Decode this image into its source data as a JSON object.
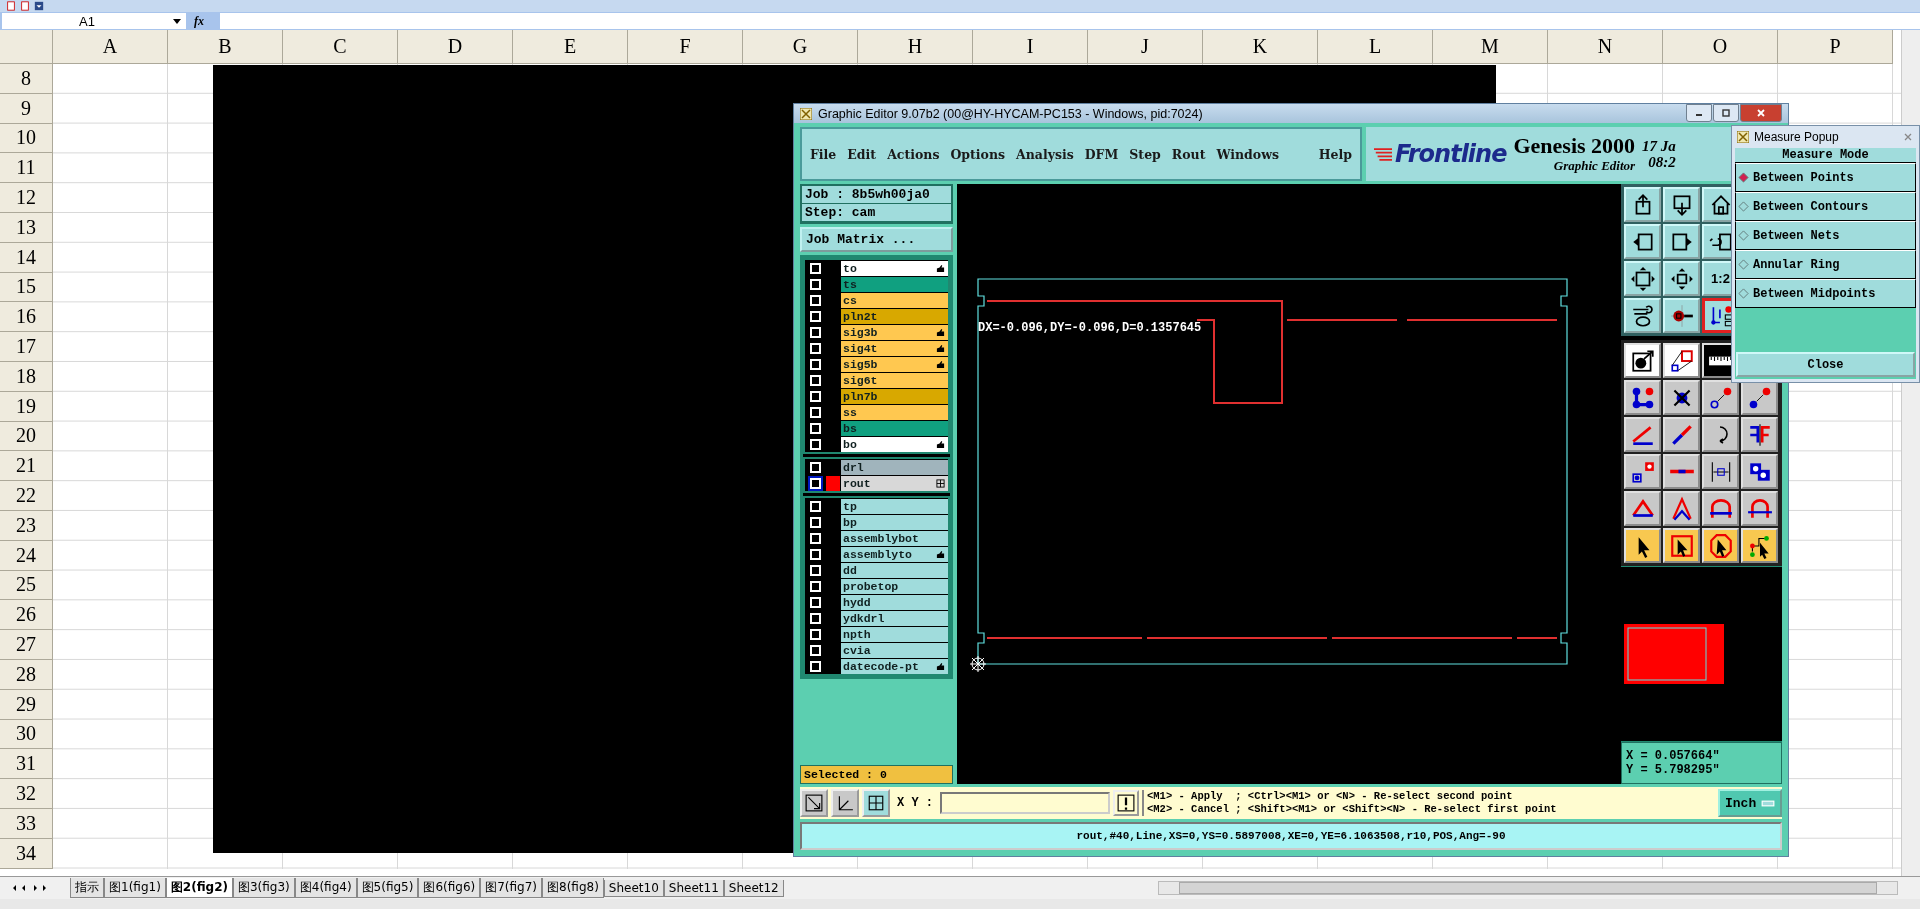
{
  "excel": {
    "name_box": "A1",
    "formula_label": "fx",
    "columns": [
      "A",
      "B",
      "C",
      "D",
      "E",
      "F",
      "G",
      "H",
      "I",
      "J",
      "K",
      "L",
      "M",
      "N",
      "O",
      "P"
    ],
    "rows": [
      "8",
      "9",
      "10",
      "11",
      "12",
      "13",
      "14",
      "15",
      "16",
      "17",
      "18",
      "19",
      "20",
      "21",
      "22",
      "23",
      "24",
      "25",
      "26",
      "27",
      "28",
      "29",
      "30",
      "31",
      "32",
      "33",
      "34"
    ],
    "sheet_tabs": [
      {
        "label": "指示",
        "selected": false
      },
      {
        "label": "图1(fig1)",
        "selected": false
      },
      {
        "label": "图2(fig2)",
        "selected": true
      },
      {
        "label": "图3(fig3)",
        "selected": false
      },
      {
        "label": "图4(fig4)",
        "selected": false
      },
      {
        "label": "图5(fig5)",
        "selected": false
      },
      {
        "label": "图6(fig6)",
        "selected": false
      },
      {
        "label": "图7(fig7)",
        "selected": false
      },
      {
        "label": "图8(fig8)",
        "selected": false
      },
      {
        "label": "Sheet10",
        "selected": false
      },
      {
        "label": "Sheet11",
        "selected": false
      },
      {
        "label": "Sheet12",
        "selected": false
      }
    ]
  },
  "editor": {
    "title": "Graphic Editor 9.07b2 (00@HY-HYCAM-PC153 - Windows, pid:7024)",
    "menus": [
      "File",
      "Edit",
      "Actions",
      "Options",
      "Analysis",
      "DFM",
      "Step",
      "Rout",
      "Windows",
      "Help"
    ],
    "brand": "Frontline",
    "product": "Genesis 2000",
    "subtitle": "Graphic Editor",
    "date": "17 Ja",
    "time": "08:2",
    "job": "Job : 8b5wh00ja0",
    "step": "Step: cam",
    "job_matrix_button": "Job Matrix ...",
    "layer_groups": [
      {
        "layers": [
          {
            "name": "to",
            "color": "#ffffff",
            "flagged": true,
            "expandable": false,
            "selected": false
          },
          {
            "name": "ts",
            "color": "#10a080",
            "flagged": false,
            "expandable": false,
            "selected": false
          },
          {
            "name": "cs",
            "color": "#ffc850",
            "flagged": false,
            "expandable": false,
            "selected": false
          },
          {
            "name": "pln2t",
            "color": "#d8a800",
            "flagged": false,
            "expandable": false,
            "selected": false
          },
          {
            "name": "sig3b",
            "color": "#ffc850",
            "flagged": true,
            "expandable": false,
            "selected": false
          },
          {
            "name": "sig4t",
            "color": "#ffc850",
            "flagged": true,
            "expandable": false,
            "selected": false
          },
          {
            "name": "sig5b",
            "color": "#ffc850",
            "flagged": true,
            "expandable": false,
            "selected": false
          },
          {
            "name": "sig6t",
            "color": "#ffc850",
            "flagged": false,
            "expandable": false,
            "selected": false
          },
          {
            "name": "pln7b",
            "color": "#d8a800",
            "flagged": false,
            "expandable": false,
            "selected": false
          },
          {
            "name": "ss",
            "color": "#ffc850",
            "flagged": false,
            "expandable": false,
            "selected": false
          },
          {
            "name": "bs",
            "color": "#10a080",
            "flagged": false,
            "expandable": false,
            "selected": false
          },
          {
            "name": "bo",
            "color": "#ffffff",
            "flagged": true,
            "expandable": false,
            "selected": false
          }
        ]
      },
      {
        "layers": [
          {
            "name": "drl",
            "color": "#a0b4bc",
            "flagged": false,
            "expandable": false,
            "selected": false
          },
          {
            "name": "rout",
            "color": "#d8d8d8",
            "flagged": false,
            "expandable": true,
            "selected": true
          }
        ]
      },
      {
        "layers": [
          {
            "name": "tp",
            "color": "#a0dcdc",
            "flagged": false,
            "expandable": false,
            "selected": false
          },
          {
            "name": "bp",
            "color": "#a0dcdc",
            "flagged": false,
            "expandable": false,
            "selected": false
          },
          {
            "name": "assemblybot",
            "color": "#a0dcdc",
            "flagged": false,
            "expandable": false,
            "selected": false
          },
          {
            "name": "assemblyto",
            "color": "#a0dcdc",
            "flagged": true,
            "expandable": false,
            "selected": false
          },
          {
            "name": "dd",
            "color": "#a0dcdc",
            "flagged": false,
            "expandable": false,
            "selected": false
          },
          {
            "name": "probetop",
            "color": "#a0dcdc",
            "flagged": false,
            "expandable": false,
            "selected": false
          },
          {
            "name": "hydd",
            "color": "#a0dcdc",
            "flagged": false,
            "expandable": false,
            "selected": false
          },
          {
            "name": "ydkdrl",
            "color": "#a0dcdc",
            "flagged": false,
            "expandable": false,
            "selected": false
          },
          {
            "name": "npth",
            "color": "#a0dcdc",
            "flagged": false,
            "expandable": false,
            "selected": false
          },
          {
            "name": "cvia",
            "color": "#a0dcdc",
            "flagged": false,
            "expandable": false,
            "selected": false
          },
          {
            "name": "datecode-pt",
            "color": "#a0dcdc",
            "flagged": true,
            "expandable": false,
            "selected": false
          }
        ]
      }
    ],
    "selected_count": "Selected : 0",
    "zoom_ratio": "1:2",
    "measure_readout": "DX=-0.096,DY=-0.096,D=0.1357645",
    "coord_x": "X = 0.057664\"",
    "coord_y": "Y = 5.798295\"",
    "xy_label": "X Y :",
    "hints": [
      "<M1> - Apply  ; <Ctrl><M1> or <N> - Re-select second point",
      "<M2> - Cancel ; <Shift><M1> or <Shift><N> - Re-select first point"
    ],
    "unit": "Inch",
    "status": "rout,#40,Line,XS=0,YS=0.5897008,XE=0,YE=6.1063508,r10,POS,Ang=-90"
  },
  "measure_popup": {
    "title": "Measure Popup",
    "mode_heading": "Measure Mode",
    "options": [
      {
        "label": "Between Points",
        "selected": true
      },
      {
        "label": "Between Contours",
        "selected": false
      },
      {
        "label": "Between Nets",
        "selected": false
      },
      {
        "label": "Annular Ring",
        "selected": false
      },
      {
        "label": "Between Midpoints",
        "selected": false
      }
    ],
    "close_button": "Close"
  }
}
